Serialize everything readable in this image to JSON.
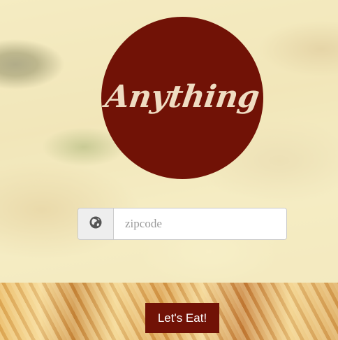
{
  "logo": {
    "text": "Anything",
    "circle_color": "#711206",
    "text_color": "#efdcc2"
  },
  "search": {
    "icon": "globe-icon",
    "placeholder": "zipcode",
    "value": ""
  },
  "cta": {
    "label": "Let's Eat!",
    "color": "#711206"
  }
}
